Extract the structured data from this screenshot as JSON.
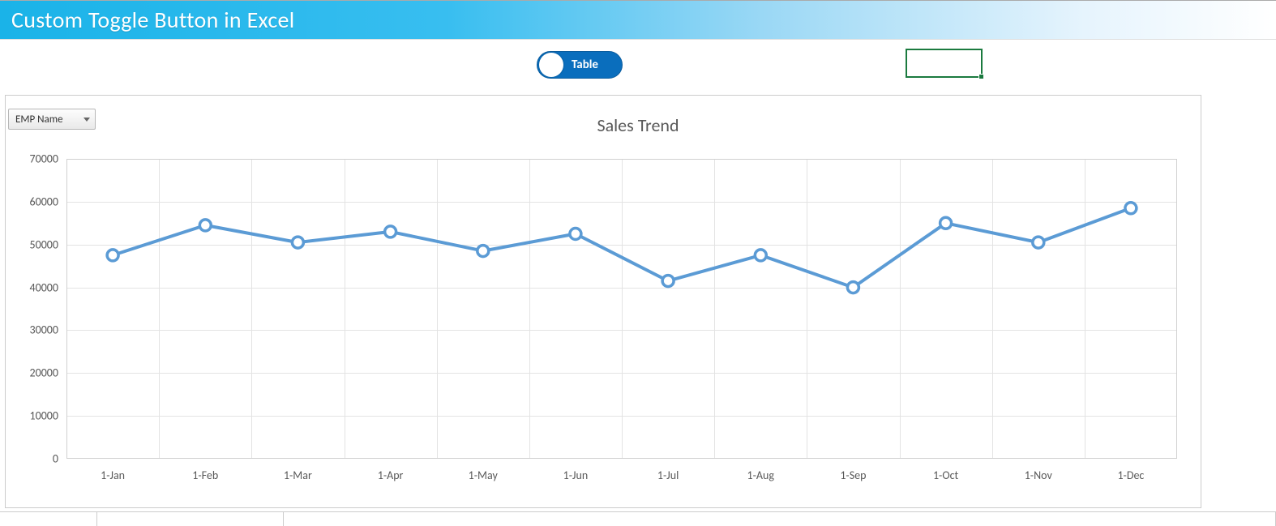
{
  "header": {
    "title": "Custom Toggle Button in Excel"
  },
  "toggle": {
    "label": "Table"
  },
  "slicer": {
    "label": "EMP Name"
  },
  "chart_data": {
    "type": "line",
    "title": "Sales Trend",
    "xlabel": "",
    "ylabel": "",
    "ylim": [
      0,
      70000
    ],
    "yticks": [
      0,
      10000,
      20000,
      30000,
      40000,
      50000,
      60000,
      70000
    ],
    "categories": [
      "1-Jan",
      "1-Feb",
      "1-Mar",
      "1-Apr",
      "1-May",
      "1-Jun",
      "1-Jul",
      "1-Aug",
      "1-Sep",
      "1-Oct",
      "1-Nov",
      "1-Dec"
    ],
    "values": [
      47500,
      54500,
      50500,
      53000,
      48500,
      52500,
      41500,
      47500,
      40000,
      55000,
      50500,
      58500
    ]
  },
  "colors": {
    "line": "#5B9BD5",
    "marker_fill": "#ffffff",
    "marker_stroke": "#5B9BD5"
  }
}
